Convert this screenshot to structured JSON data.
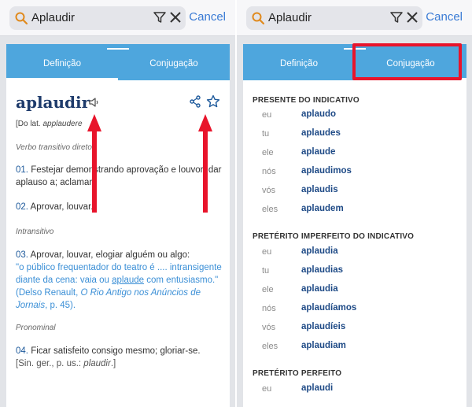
{
  "left": {
    "search": {
      "query": "Aplaudir",
      "cancel_label": "Cancel"
    },
    "tabs": {
      "definicao": "Definição",
      "conjugacao": "Conjugação"
    },
    "entry": {
      "headword": "aplaudir",
      "etymology_prefix": "[Do lat. ",
      "etymology_word": "applaudere",
      "senses": [
        {
          "category": "Verbo transitivo direto"
        },
        {
          "number": "01.",
          "text": " Festejar demonstrando aprovação e louvor; dar aplauso a; aclamar."
        },
        {
          "number": "02.",
          "text": " Aprovar, louvar."
        },
        {
          "category": "Intransitivo"
        },
        {
          "number": "03.",
          "text": " Aprovar, louvar, elogiar alguém ou algo:"
        },
        {
          "category": "Pronominal"
        },
        {
          "number": "04.",
          "text": " Ficar satisfeito consigo mesmo; gloriar-se."
        }
      ],
      "quote_part1": " \"o público frequentador do teatro é .... intransigente diante da cena: vaia ou ",
      "quote_link": "aplaude",
      "quote_part2": " com entusiasmo.\" (Delso Renault, ",
      "quote_source": "O Rio Antigo nos Anúncios de Jornais",
      "quote_page": ", p. 45).",
      "sin_prefix": "[Sin. ger., p. us.: ",
      "sin_word": "plaudir",
      "sin_suffix": ".]"
    }
  },
  "right": {
    "search": {
      "query": "Aplaudir",
      "cancel_label": "Cancel"
    },
    "tabs": {
      "definicao": "Definição",
      "conjugacao": "Conjugação"
    },
    "conjugation": [
      {
        "tense": "PRESENTE DO INDICATIVO",
        "rows": [
          {
            "pronoun": "eu",
            "form": "aplaudo"
          },
          {
            "pronoun": "tu",
            "form": "aplaudes"
          },
          {
            "pronoun": "ele",
            "form": "aplaude"
          },
          {
            "pronoun": "nós",
            "form": "aplaudimos"
          },
          {
            "pronoun": "vós",
            "form": "aplaudis"
          },
          {
            "pronoun": "eles",
            "form": "aplaudem"
          }
        ]
      },
      {
        "tense": "PRETÉRITO IMPERFEITO DO INDICATIVO",
        "rows": [
          {
            "pronoun": "eu",
            "form": "aplaudia"
          },
          {
            "pronoun": "tu",
            "form": "aplaudias"
          },
          {
            "pronoun": "ele",
            "form": "aplaudia"
          },
          {
            "pronoun": "nós",
            "form": "aplaudíamos"
          },
          {
            "pronoun": "vós",
            "form": "aplaudíeis"
          },
          {
            "pronoun": "eles",
            "form": "aplaudiam"
          }
        ]
      },
      {
        "tense": "PRETÉRITO PERFEITO",
        "rows": [
          {
            "pronoun": "eu",
            "form": "aplaudi"
          }
        ]
      }
    ]
  },
  "colors": {
    "accent": "#4ea6dd",
    "headword": "#1e3b6b",
    "link": "#3b8fd6",
    "annotation_red": "#e8142b"
  }
}
